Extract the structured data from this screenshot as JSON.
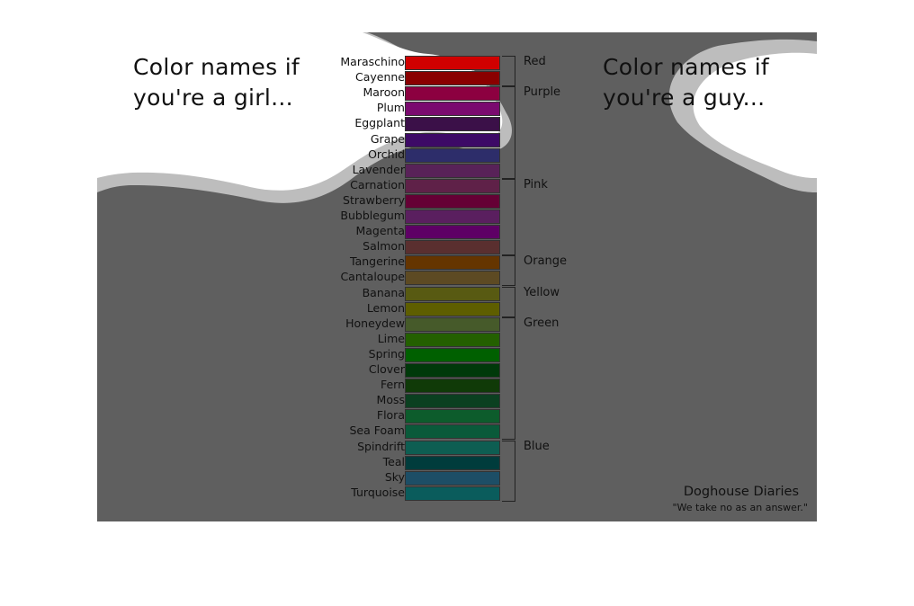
{
  "girl_heading": [
    "Color names if",
    "you're a girl..."
  ],
  "guy_heading": [
    "Color names if",
    "you're a guy..."
  ],
  "colors": [
    {
      "name": "Maraschino",
      "color": "#d00000"
    },
    {
      "name": "Cayenne",
      "color": "#8a0000"
    },
    {
      "name": "Maroon",
      "color": "#8c0040"
    },
    {
      "name": "Plum",
      "color": "#7a0a6f"
    },
    {
      "name": "Eggplant",
      "color": "#3b1048"
    },
    {
      "name": "Grape",
      "color": "#3d0a66"
    },
    {
      "name": "Orchid",
      "color": "#2d2d6a"
    },
    {
      "name": "Lavender",
      "color": "#582258"
    },
    {
      "name": "Carnation",
      "color": "#5f2148"
    },
    {
      "name": "Strawberry",
      "color": "#650035"
    },
    {
      "name": "Bubblegum",
      "color": "#5a1f5f"
    },
    {
      "name": "Magenta",
      "color": "#5e0065"
    },
    {
      "name": "Salmon",
      "color": "#5a2f2f"
    },
    {
      "name": "Tangerine",
      "color": "#653500"
    },
    {
      "name": "Cantaloupe",
      "color": "#5d4a23"
    },
    {
      "name": "Banana",
      "color": "#585a12"
    },
    {
      "name": "Lemon",
      "color": "#5e5e00"
    },
    {
      "name": "Honeydew",
      "color": "#465a2a"
    },
    {
      "name": "Lime",
      "color": "#246000"
    },
    {
      "name": "Spring",
      "color": "#006000"
    },
    {
      "name": "Clover",
      "color": "#00390a"
    },
    {
      "name": "Fern",
      "color": "#103a08"
    },
    {
      "name": "Moss",
      "color": "#0b4020"
    },
    {
      "name": "Flora",
      "color": "#0d5c2c"
    },
    {
      "name": "Sea Foam",
      "color": "#0a5a3a"
    },
    {
      "name": "Spindrift",
      "color": "#0e5e52"
    },
    {
      "name": "Teal",
      "color": "#003c3c"
    },
    {
      "name": "Sky",
      "color": "#1d4e66"
    },
    {
      "name": "Turquoise",
      "color": "#0a5c5c"
    }
  ],
  "groups": [
    {
      "label": "Red",
      "start": 0,
      "end": 1
    },
    {
      "label": "Purple",
      "start": 2,
      "end": 7
    },
    {
      "label": "Pink",
      "start": 8,
      "end": 12
    },
    {
      "label": "Orange",
      "start": 13,
      "end": 14
    },
    {
      "label": "Yellow",
      "start": 15,
      "end": 16
    },
    {
      "label": "Green",
      "start": 17,
      "end": 24
    },
    {
      "label": "Blue",
      "start": 25,
      "end": 28
    }
  ],
  "credit": {
    "title": "Doghouse Diaries",
    "subtitle": "\"We take no as an answer.\""
  },
  "palette": {
    "background": "#5f5f5f",
    "blob_white": "#ffffff",
    "blob_outline": "#bdbdbd",
    "text": "#111111"
  }
}
